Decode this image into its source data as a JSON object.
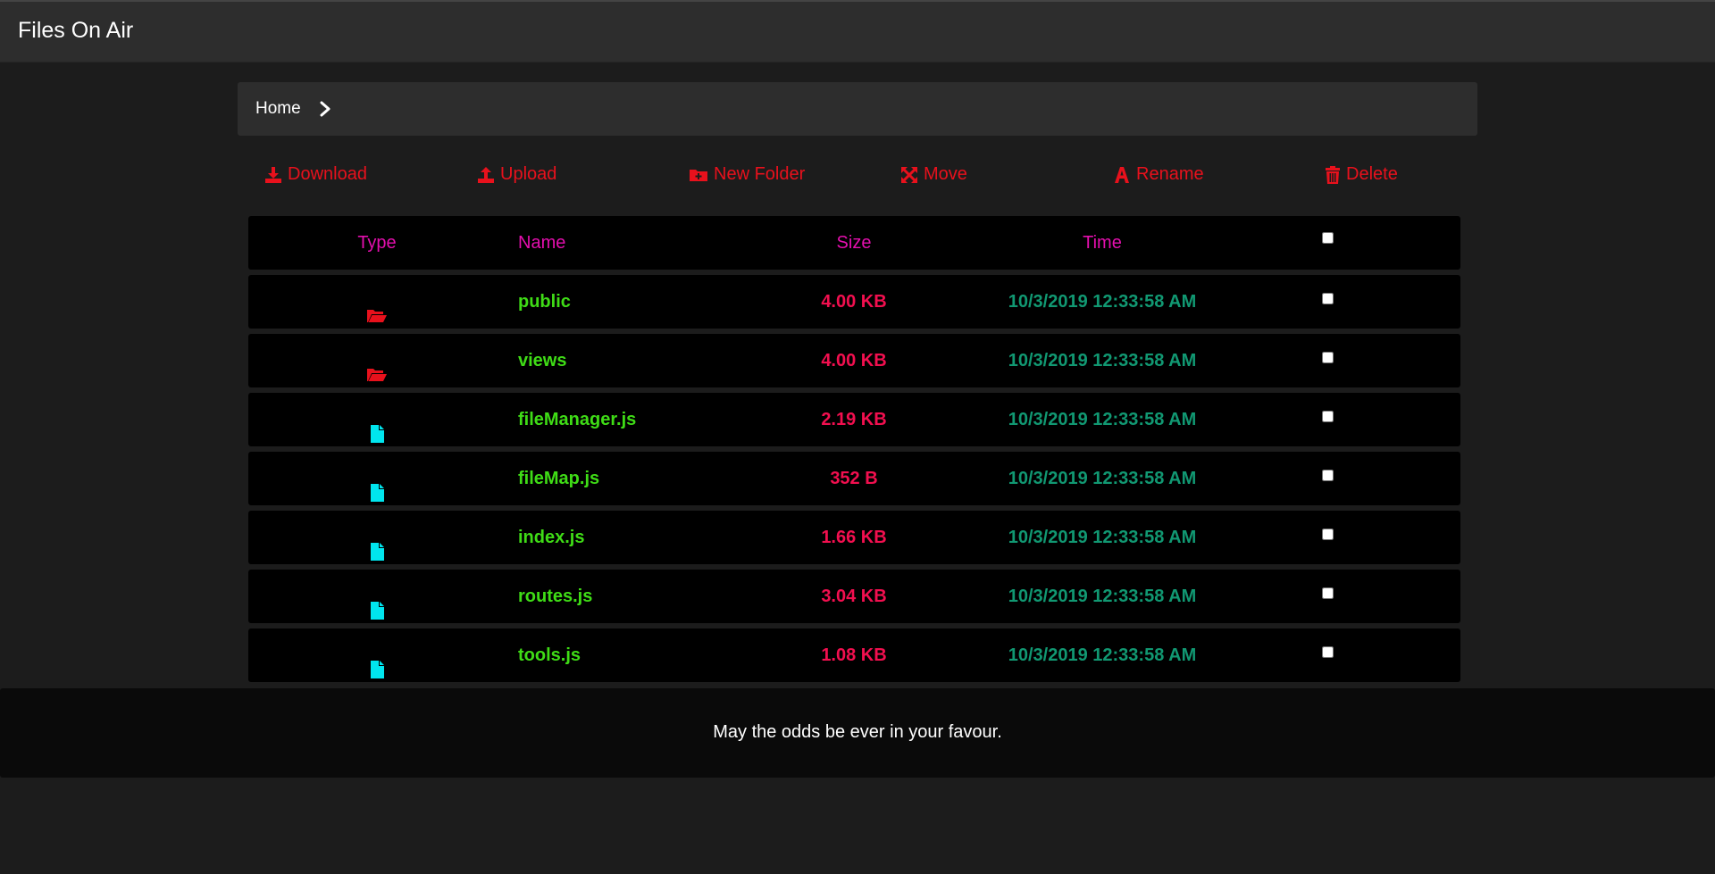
{
  "app": {
    "title": "Files On Air"
  },
  "breadcrumb": {
    "home": "Home"
  },
  "toolbar": {
    "download": "Download",
    "upload": "Upload",
    "new_folder": "New Folder",
    "move": "Move",
    "rename": "Rename",
    "delete": "Delete"
  },
  "table": {
    "headers": {
      "type": "Type",
      "name": "Name",
      "size": "Size",
      "time": "Time"
    },
    "rows": [
      {
        "type": "folder",
        "icon": "folder-open-icon",
        "name": "public",
        "size": "4.00 KB",
        "time": "10/3/2019 12:33:58 AM",
        "checked": false
      },
      {
        "type": "folder",
        "icon": "folder-open-icon",
        "name": "views",
        "size": "4.00 KB",
        "time": "10/3/2019 12:33:58 AM",
        "checked": false
      },
      {
        "type": "file",
        "icon": "file-icon",
        "name": "fileManager.js",
        "size": "2.19 KB",
        "time": "10/3/2019 12:33:58 AM",
        "checked": false
      },
      {
        "type": "file",
        "icon": "file-icon",
        "name": "fileMap.js",
        "size": "352 B",
        "time": "10/3/2019 12:33:58 AM",
        "checked": false
      },
      {
        "type": "file",
        "icon": "file-icon",
        "name": "index.js",
        "size": "1.66 KB",
        "time": "10/3/2019 12:33:58 AM",
        "checked": false
      },
      {
        "type": "file",
        "icon": "file-icon",
        "name": "routes.js",
        "size": "3.04 KB",
        "time": "10/3/2019 12:33:58 AM",
        "checked": false
      },
      {
        "type": "file",
        "icon": "file-icon",
        "name": "tools.js",
        "size": "1.08 KB",
        "time": "10/3/2019 12:33:58 AM",
        "checked": false
      }
    ]
  },
  "footer": {
    "text": "May the odds be ever in your favour."
  },
  "colors": {
    "accent_red": "#e8111c",
    "header_magenta": "#e40fae",
    "name_green": "#3fdc16",
    "size_red": "#f20f4f",
    "time_teal": "#119872",
    "file_cyan": "#00e5ee",
    "folder_red": "#e8111c"
  }
}
